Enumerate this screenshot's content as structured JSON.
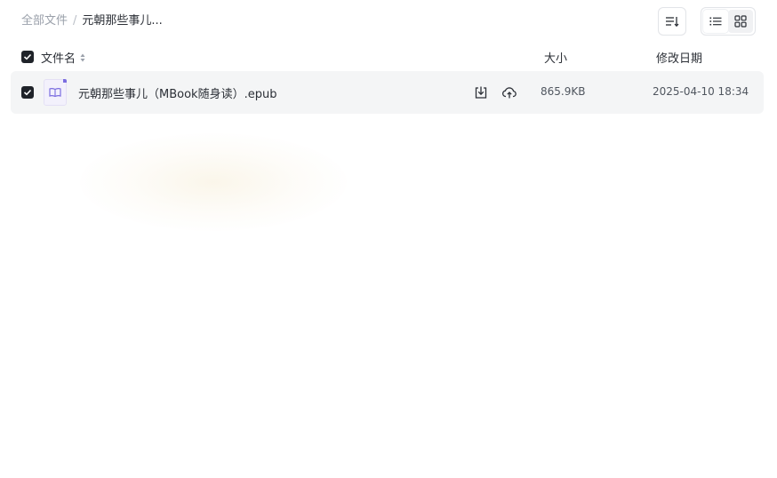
{
  "breadcrumb": {
    "root": "全部文件",
    "separator": "/",
    "current": "元朝那些事儿..."
  },
  "table": {
    "columns": {
      "name": "文件名",
      "size": "大小",
      "modified": "修改日期"
    },
    "rows": [
      {
        "name": "元朝那些事儿（MBook随身读）.epub",
        "size": "865.9KB",
        "modified": "2025-04-10 18:34",
        "selected": true,
        "icon": "book-icon"
      }
    ]
  },
  "toolbar": {
    "sort_icon": "sort-icon",
    "view_modes": [
      "list",
      "grid"
    ],
    "active_view": "list"
  },
  "colors": {
    "checkbox": "#1f2329",
    "row_highlight": "#f4f5f6",
    "file_icon_accent": "#7b6de0"
  }
}
